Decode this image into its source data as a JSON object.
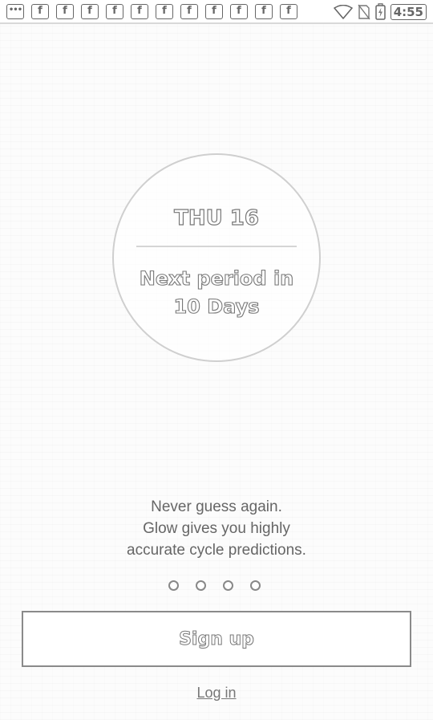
{
  "status_bar": {
    "notifications": [
      "more",
      "f",
      "f",
      "f",
      "f",
      "f",
      "f",
      "f",
      "f",
      "f",
      "f",
      "f"
    ],
    "more_glyph": "•••",
    "facebook_glyph": "f",
    "icons": [
      "wifi-icon",
      "no-sim-icon",
      "battery-charging-icon"
    ],
    "time": "4:55"
  },
  "circle": {
    "day": "THU 16",
    "next_period_line1": "Next period in",
    "next_period_line2": "10 Days"
  },
  "tagline": {
    "line1": "Never guess again.",
    "line2": "Glow gives you highly",
    "line3": "accurate cycle predictions."
  },
  "pager": {
    "count": 4
  },
  "actions": {
    "signup_label": "Sign up",
    "login_label": "Log in"
  }
}
